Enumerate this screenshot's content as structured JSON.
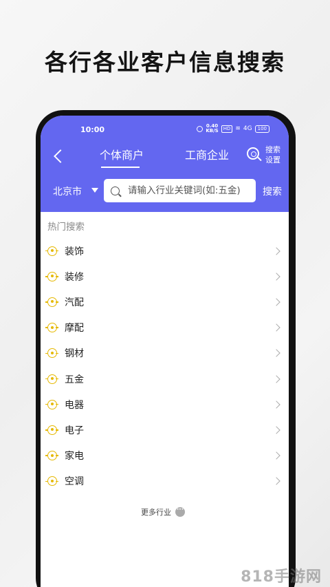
{
  "promo": {
    "title": "各行各业客户信息搜索"
  },
  "status_bar": {
    "time": "10:00",
    "speed": "0.40\nKB/S",
    "hd": "HD",
    "signal": "4G",
    "battery": "100"
  },
  "header": {
    "tabs": [
      {
        "label": "个体商户",
        "active": true
      },
      {
        "label": "工商企业",
        "active": false
      }
    ],
    "settings_label": "搜索\n设置"
  },
  "search": {
    "city": "北京市",
    "placeholder": "请输入行业关键词(如:五金)",
    "button_label": "搜索"
  },
  "hot": {
    "title": "热门搜索",
    "items": [
      {
        "label": "装饰"
      },
      {
        "label": "装修"
      },
      {
        "label": "汽配"
      },
      {
        "label": "摩配"
      },
      {
        "label": "钢材"
      },
      {
        "label": "五金"
      },
      {
        "label": "电器"
      },
      {
        "label": "电子"
      },
      {
        "label": "家电"
      },
      {
        "label": "空调"
      }
    ],
    "more_label": "更多行业",
    "more_icon": "···"
  },
  "watermark": "818手游网",
  "colors": {
    "accent": "#6367f0",
    "icon": "#e5b800"
  }
}
